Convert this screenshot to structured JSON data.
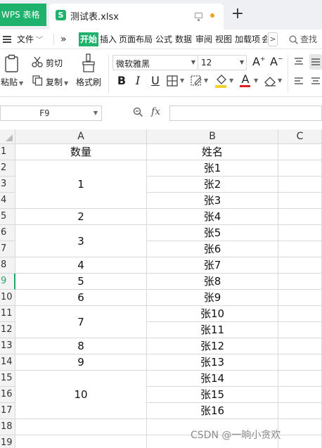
{
  "titlebar": {
    "app_tab": "WPS 表格",
    "file_tab": "测试表.xlsx",
    "file_icon": "S",
    "new_tab_symbol": "+"
  },
  "menubar": {
    "file_menu": "文件",
    "more_symbol": "»",
    "tabs": [
      "开始",
      "插入",
      "页面布局",
      "公式",
      "数据",
      "审阅",
      "视图",
      "加载项",
      "会"
    ],
    "active_tab": "开始",
    "search_label": "查找",
    "overflow_symbol": ">"
  },
  "ribbon": {
    "paste": "粘贴",
    "cut": "剪切",
    "copy": "复制",
    "format_painter": "格式刷",
    "font_name": "微软雅黑",
    "font_size": "12",
    "bold": "B",
    "italic": "I",
    "underline": "U"
  },
  "formula_bar": {
    "name_box": "F9",
    "fx_label": "fx",
    "formula": ""
  },
  "sheet": {
    "columns": [
      "A",
      "B",
      "C"
    ],
    "rows": [
      "1",
      "2",
      "3",
      "4",
      "5",
      "6",
      "7",
      "8",
      "9",
      "10",
      "11",
      "12",
      "13",
      "14",
      "15",
      "16",
      "17",
      "18",
      "19"
    ],
    "selected_row": "9",
    "header_a": "数量",
    "header_b": "姓名",
    "col_a_values": [
      "1",
      "2",
      "3",
      "4",
      "5",
      "6",
      "7",
      "8",
      "9",
      "10"
    ],
    "col_b_values": [
      "张1",
      "张2",
      "张3",
      "张4",
      "张5",
      "张6",
      "张7",
      "张8",
      "张9",
      "张10",
      "张11",
      "张12",
      "张13",
      "张14",
      "张15",
      "张16"
    ]
  },
  "watermark": "CSDN @一晌小贪欢",
  "colors": {
    "wps_green": "#1fb26d",
    "selected_row_header": "#1fa866",
    "grid_line": "#d8d8d8",
    "header_bg": "#f3f3f3"
  }
}
